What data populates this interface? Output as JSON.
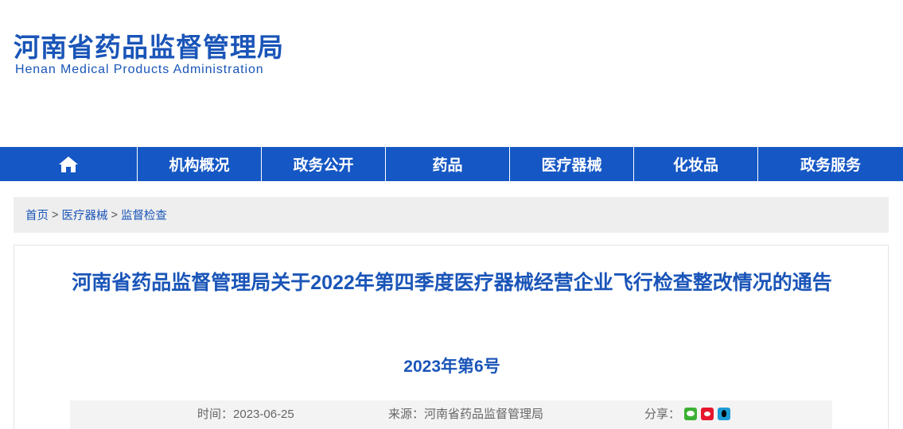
{
  "header": {
    "title_cn": "河南省药品监督管理局",
    "title_en": "Henan Medical Products Administration"
  },
  "nav": {
    "home_icon": "home-icon",
    "items": [
      "机构概况",
      "政务公开",
      "药品",
      "医疗器械",
      "化妆品",
      "政务服务"
    ]
  },
  "breadcrumb": {
    "home": "首页",
    "level1": "医疗器械",
    "level2": "监督检查",
    "separator": ">"
  },
  "article": {
    "title": "河南省药品监督管理局关于2022年第四季度医疗器械经营企业飞行检查整改情况的通告",
    "doc_number": "2023年第6号",
    "time_label": "时间：",
    "time_value": "2023-06-25",
    "source_label": "来源：",
    "source_value": "河南省药品监督管理局",
    "share_label": "分享：",
    "share_icons": [
      "wechat-icon",
      "weibo-icon",
      "qq-icon"
    ]
  },
  "colors": {
    "brand_blue": "#1a55b8",
    "nav_blue": "#1557c4",
    "breadcrumb_bg": "#eeeeee"
  }
}
